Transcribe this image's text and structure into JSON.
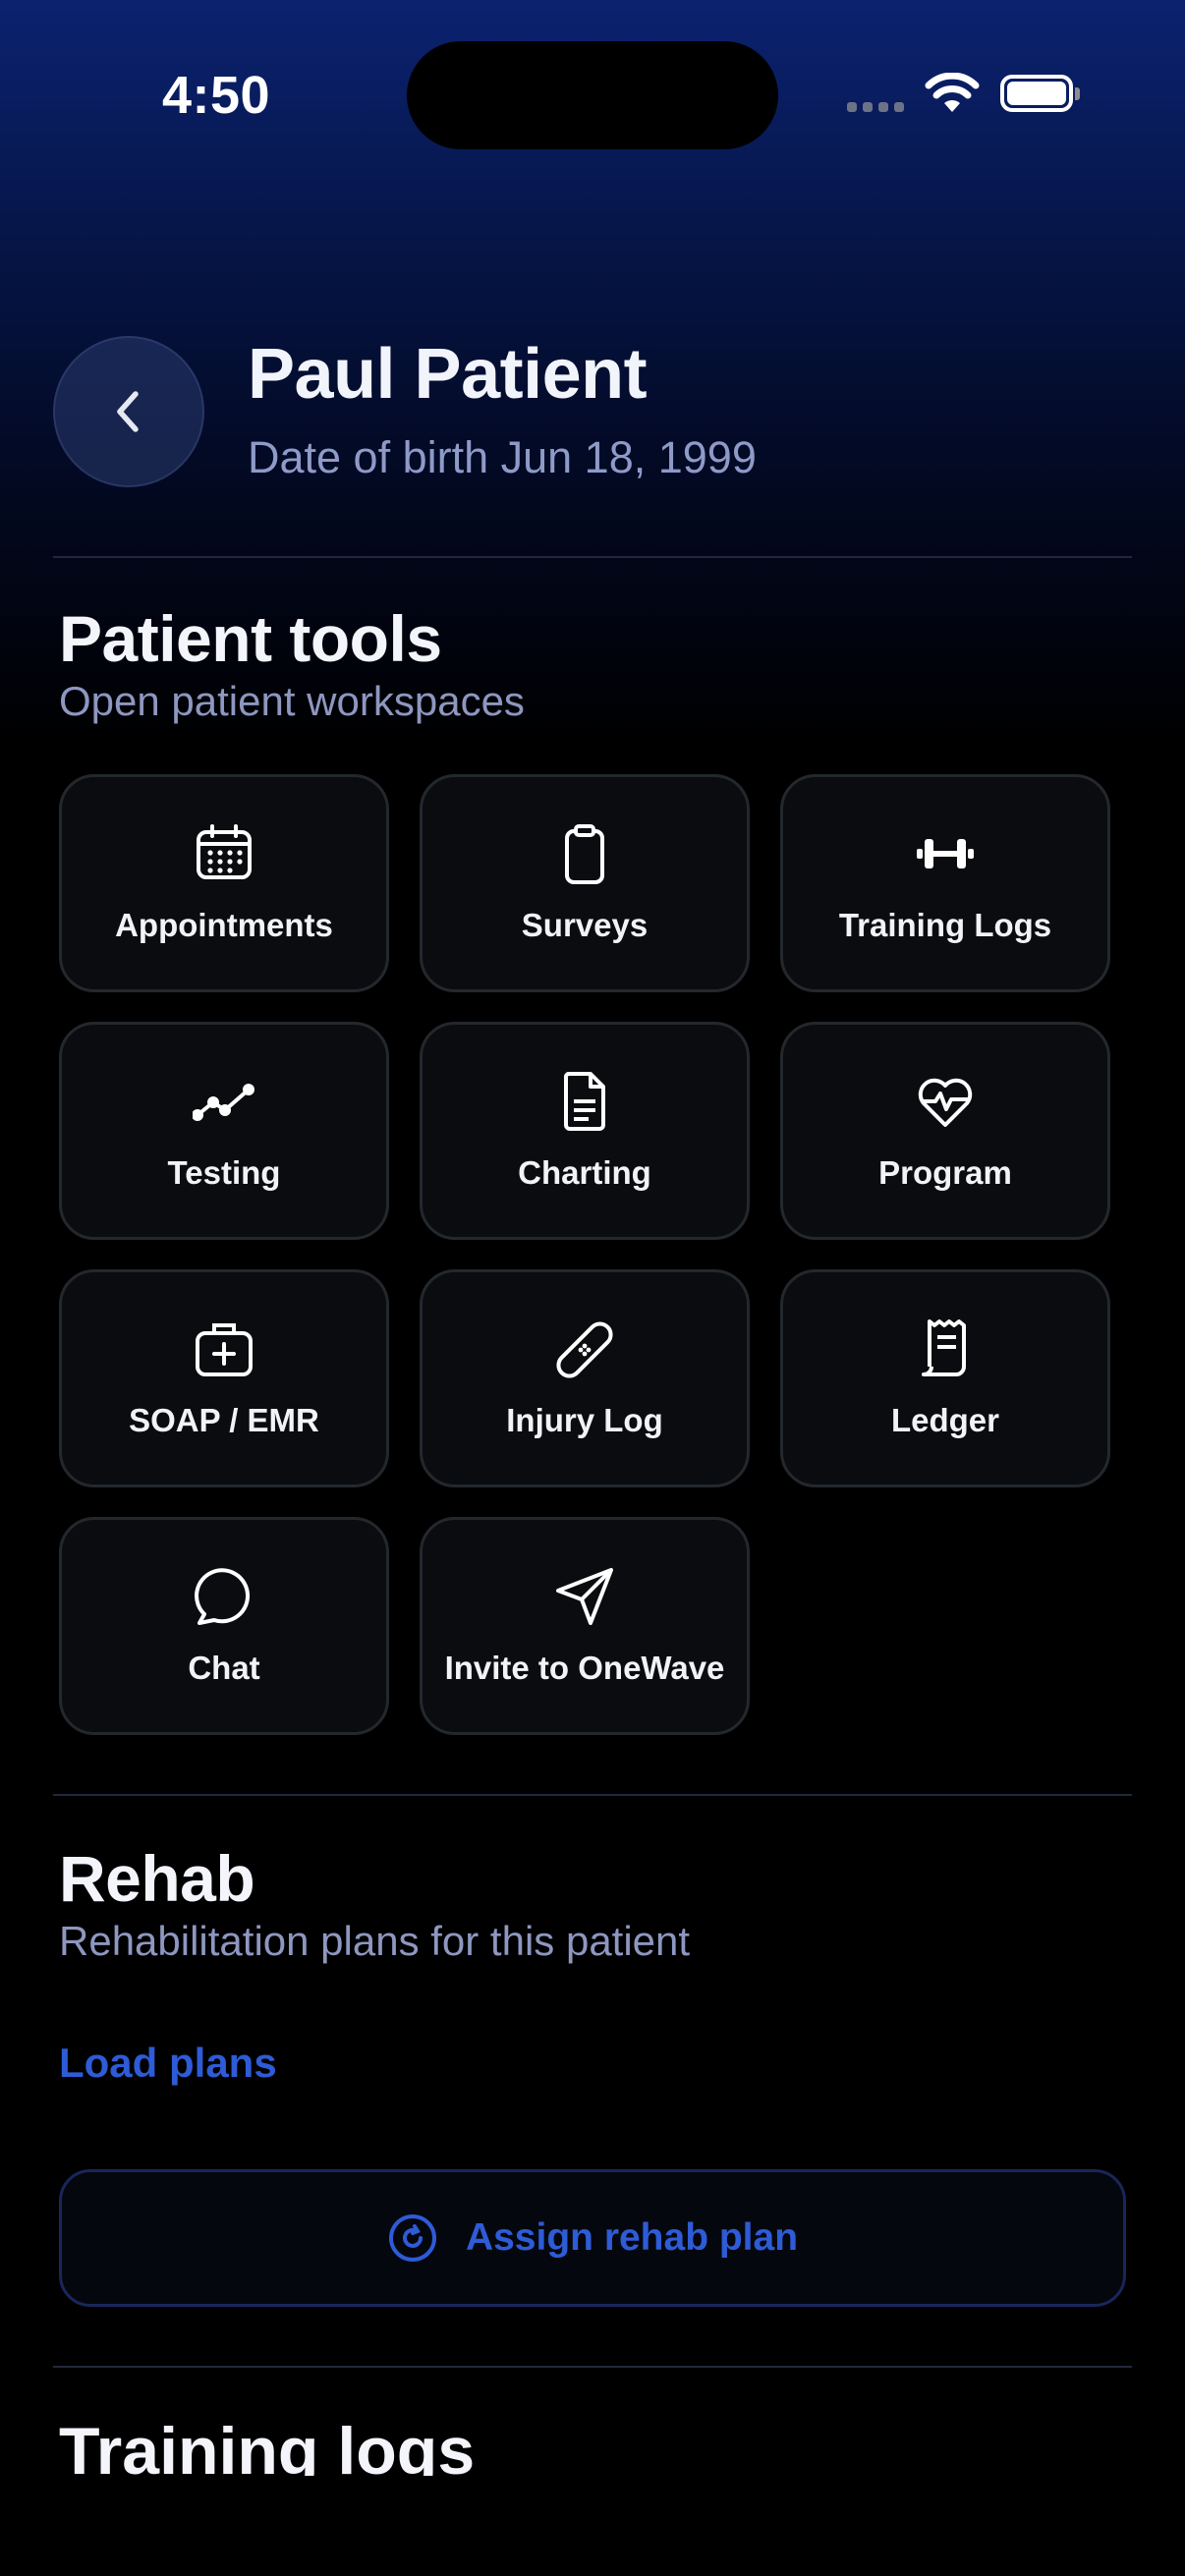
{
  "status_bar": {
    "time": "4:50"
  },
  "header": {
    "patient_name": "Paul Patient",
    "dob": "Date of birth Jun 18, 1999"
  },
  "patient_tools": {
    "title": "Patient tools",
    "subtitle": "Open patient workspaces",
    "tiles": [
      {
        "label": "Appointments",
        "icon": "calendar-icon"
      },
      {
        "label": "Surveys",
        "icon": "clipboard-icon"
      },
      {
        "label": "Training Logs",
        "icon": "dumbbell-icon"
      },
      {
        "label": "Testing",
        "icon": "trend-line-icon"
      },
      {
        "label": "Charting",
        "icon": "document-icon"
      },
      {
        "label": "Program",
        "icon": "heart-pulse-icon"
      },
      {
        "label": "SOAP / EMR",
        "icon": "medical-kit-icon"
      },
      {
        "label": "Injury Log",
        "icon": "bandage-icon"
      },
      {
        "label": "Ledger",
        "icon": "receipt-icon"
      },
      {
        "label": "Chat",
        "icon": "chat-bubble-icon"
      },
      {
        "label": "Invite to OneWave",
        "icon": "send-icon"
      }
    ]
  },
  "rehab": {
    "title": "Rehab",
    "subtitle": "Rehabilitation plans for this patient",
    "load_plans": "Load plans",
    "assign_button": "Assign rehab plan"
  },
  "training_logs": {
    "title": "Training logs"
  },
  "colors": {
    "accent": "#2E5BD6",
    "tile_bg": "#0B0C0F",
    "tile_border": "#23282D"
  }
}
